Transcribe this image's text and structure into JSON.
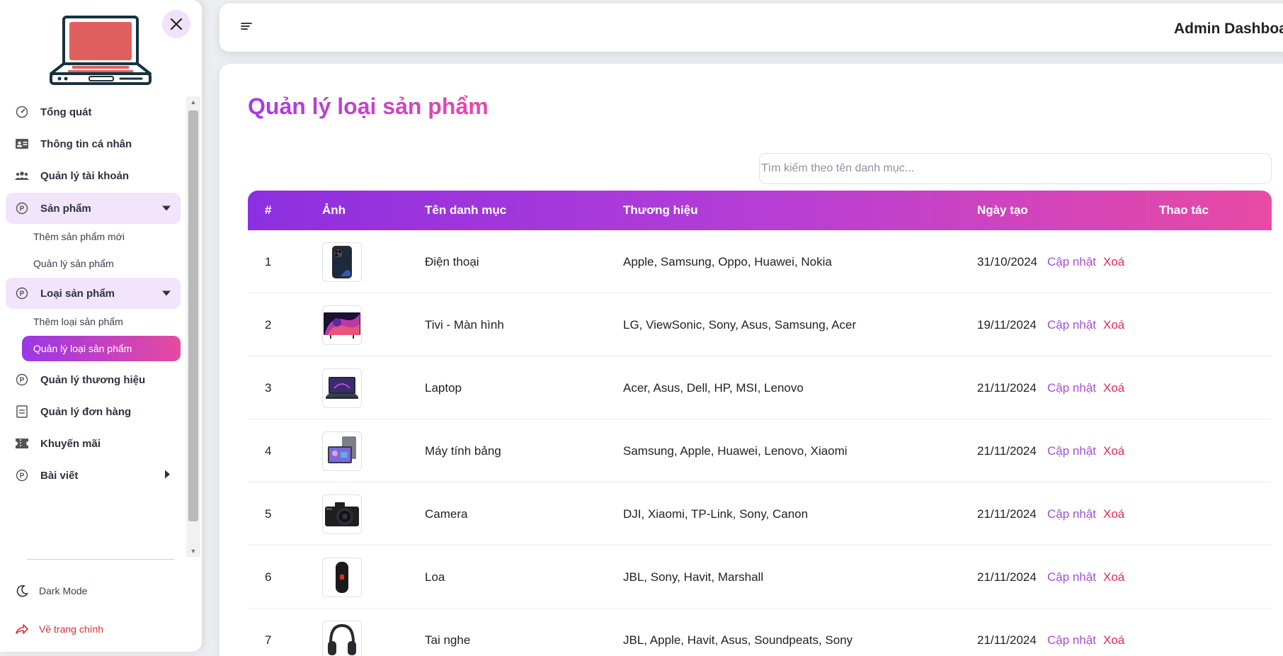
{
  "header": {
    "title": "Admin Dashboa"
  },
  "sidebar": {
    "items": [
      {
        "label": "Tổng quát",
        "icon": "gauge-icon"
      },
      {
        "label": "Thông tin cá nhân",
        "icon": "id-card-icon"
      },
      {
        "label": "Quản lý tài khoản",
        "icon": "users-icon"
      },
      {
        "label": "Sản phẩm",
        "icon": "product-icon",
        "expanded": true,
        "children": [
          {
            "label": "Thêm sản phẩm mới"
          },
          {
            "label": "Quản lý sản phẩm"
          }
        ]
      },
      {
        "label": "Loại sản phẩm",
        "icon": "product-icon",
        "expanded": true,
        "children": [
          {
            "label": "Thêm loại sản phẩm"
          },
          {
            "label": "Quản lý loại sản phẩm",
            "active": true
          }
        ]
      },
      {
        "label": "Quản lý thương hiệu",
        "icon": "product-icon"
      },
      {
        "label": "Quản lý đơn hàng",
        "icon": "order-icon"
      },
      {
        "label": "Khuyến mãi",
        "icon": "ticket-icon"
      },
      {
        "label": "Bài viết",
        "icon": "product-icon",
        "expanded": false
      }
    ],
    "dark_mode": "Dark Mode",
    "back_home": "Về trang chính"
  },
  "main": {
    "title": "Quản lý loại sản phẩm",
    "search_placeholder": "Tìm kiếm theo tên danh mục...",
    "columns": [
      "#",
      "Ảnh",
      "Tên danh mục",
      "Thương hiệu",
      "Ngày tạo",
      "Thao tác"
    ],
    "update_label": "Cập nhật",
    "delete_label": "Xoá",
    "rows": [
      {
        "num": "1",
        "image": "phone-image",
        "name": "Điện thoại",
        "brands": "Apple, Samsung, Oppo, Huawei, Nokia",
        "date": "31/10/2024"
      },
      {
        "num": "2",
        "image": "tv-image",
        "name": "Tivi - Màn hình",
        "brands": "LG, ViewSonic, Sony, Asus, Samsung, Acer",
        "date": "19/11/2024"
      },
      {
        "num": "3",
        "image": "laptop-image",
        "name": "Laptop",
        "brands": "Acer, Asus, Dell, HP, MSI, Lenovo",
        "date": "21/11/2024"
      },
      {
        "num": "4",
        "image": "tablet-image",
        "name": "Máy tính bảng",
        "brands": "Samsung, Apple, Huawei, Lenovo, Xiaomi",
        "date": "21/11/2024"
      },
      {
        "num": "5",
        "image": "camera-image",
        "name": "Camera",
        "brands": "DJI, Xiaomi, TP-Link, Sony, Canon",
        "date": "21/11/2024"
      },
      {
        "num": "6",
        "image": "speaker-image",
        "name": "Loa",
        "brands": "JBL, Sony, Havit, Marshall",
        "date": "21/11/2024"
      },
      {
        "num": "7",
        "image": "headphone-image",
        "name": "Tai nghe",
        "brands": "JBL, Apple, Havit, Asus, Soundpeats, Sony",
        "date": "21/11/2024"
      }
    ]
  },
  "colors": {
    "accent_start": "#8c2fe0",
    "accent_end": "#e84aa4",
    "update": "#a74fd3",
    "delete": "#e02d55",
    "back_home": "#d62f3a"
  }
}
